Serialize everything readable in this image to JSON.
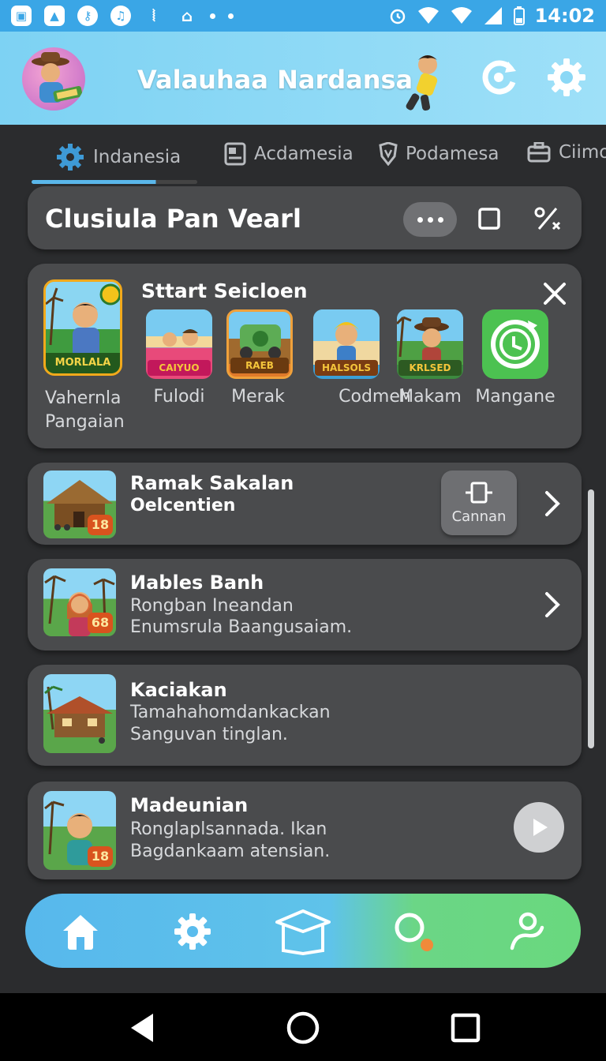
{
  "status_bar": {
    "time": "14:02",
    "left_icons": [
      "gallery-icon",
      "photo-icon",
      "key-icon",
      "signal-app-icon",
      "vibrate-icon",
      "home-app-icon"
    ]
  },
  "header": {
    "title": "Valauhaa Nardansa",
    "avatar_badge": "",
    "accent": "#7dd2f3"
  },
  "tabs": [
    {
      "label": "Indanesia",
      "icon": "gear-icon",
      "active": true
    },
    {
      "label": "Acdamesia",
      "icon": "book-icon",
      "active": false
    },
    {
      "label": "Podamesa",
      "icon": "shield-icon",
      "active": false
    },
    {
      "label": "Ciimo",
      "icon": "briefcase-icon",
      "active": false
    }
  ],
  "search_card": {
    "title": "Clusiula Pan Vearl"
  },
  "quick_start": {
    "title": "Sttart Seicloen",
    "featured": {
      "badge": "MORLALA",
      "label": "Vahernla Pangaian"
    },
    "apps": [
      {
        "label": "Fulodi",
        "badge": "CAIYUO",
        "bg": "#e84a7a"
      },
      {
        "label": "Merak",
        "badge": "RAEB",
        "bg": "#e07a2a"
      },
      {
        "label": "Codmeh",
        "badge": "HALSOLS",
        "bg": "#3b9fd6"
      },
      {
        "label": "Makam",
        "badge": "KRLSED",
        "bg": "#3c8a3f"
      },
      {
        "label": "Mangane",
        "badge": "",
        "bg": "#4cc251"
      }
    ]
  },
  "lessons": [
    {
      "title": "Ramak Sakalan",
      "subtitle": "Oelcentien",
      "subtitle2": "",
      "num": "18",
      "action_label": "Cannan"
    },
    {
      "title": "Иables Banh",
      "subtitle": "Rongban Ineandan",
      "subtitle2": "Enumsrula Baangusaiam.",
      "num": "68"
    },
    {
      "title": "Kaciakan",
      "subtitle": "Tamahahomdankackan",
      "subtitle2": "Sanguvan tinglan."
    },
    {
      "title": "Madeunian",
      "subtitle": "Ronglaplsannada. Ikan",
      "subtitle2": "Bagdankaam atensian.",
      "num": "18"
    }
  ],
  "bottom_nav": [
    "home-icon",
    "gear-icon",
    "graduation-cap-icon",
    "search-icon",
    "profile-icon"
  ]
}
